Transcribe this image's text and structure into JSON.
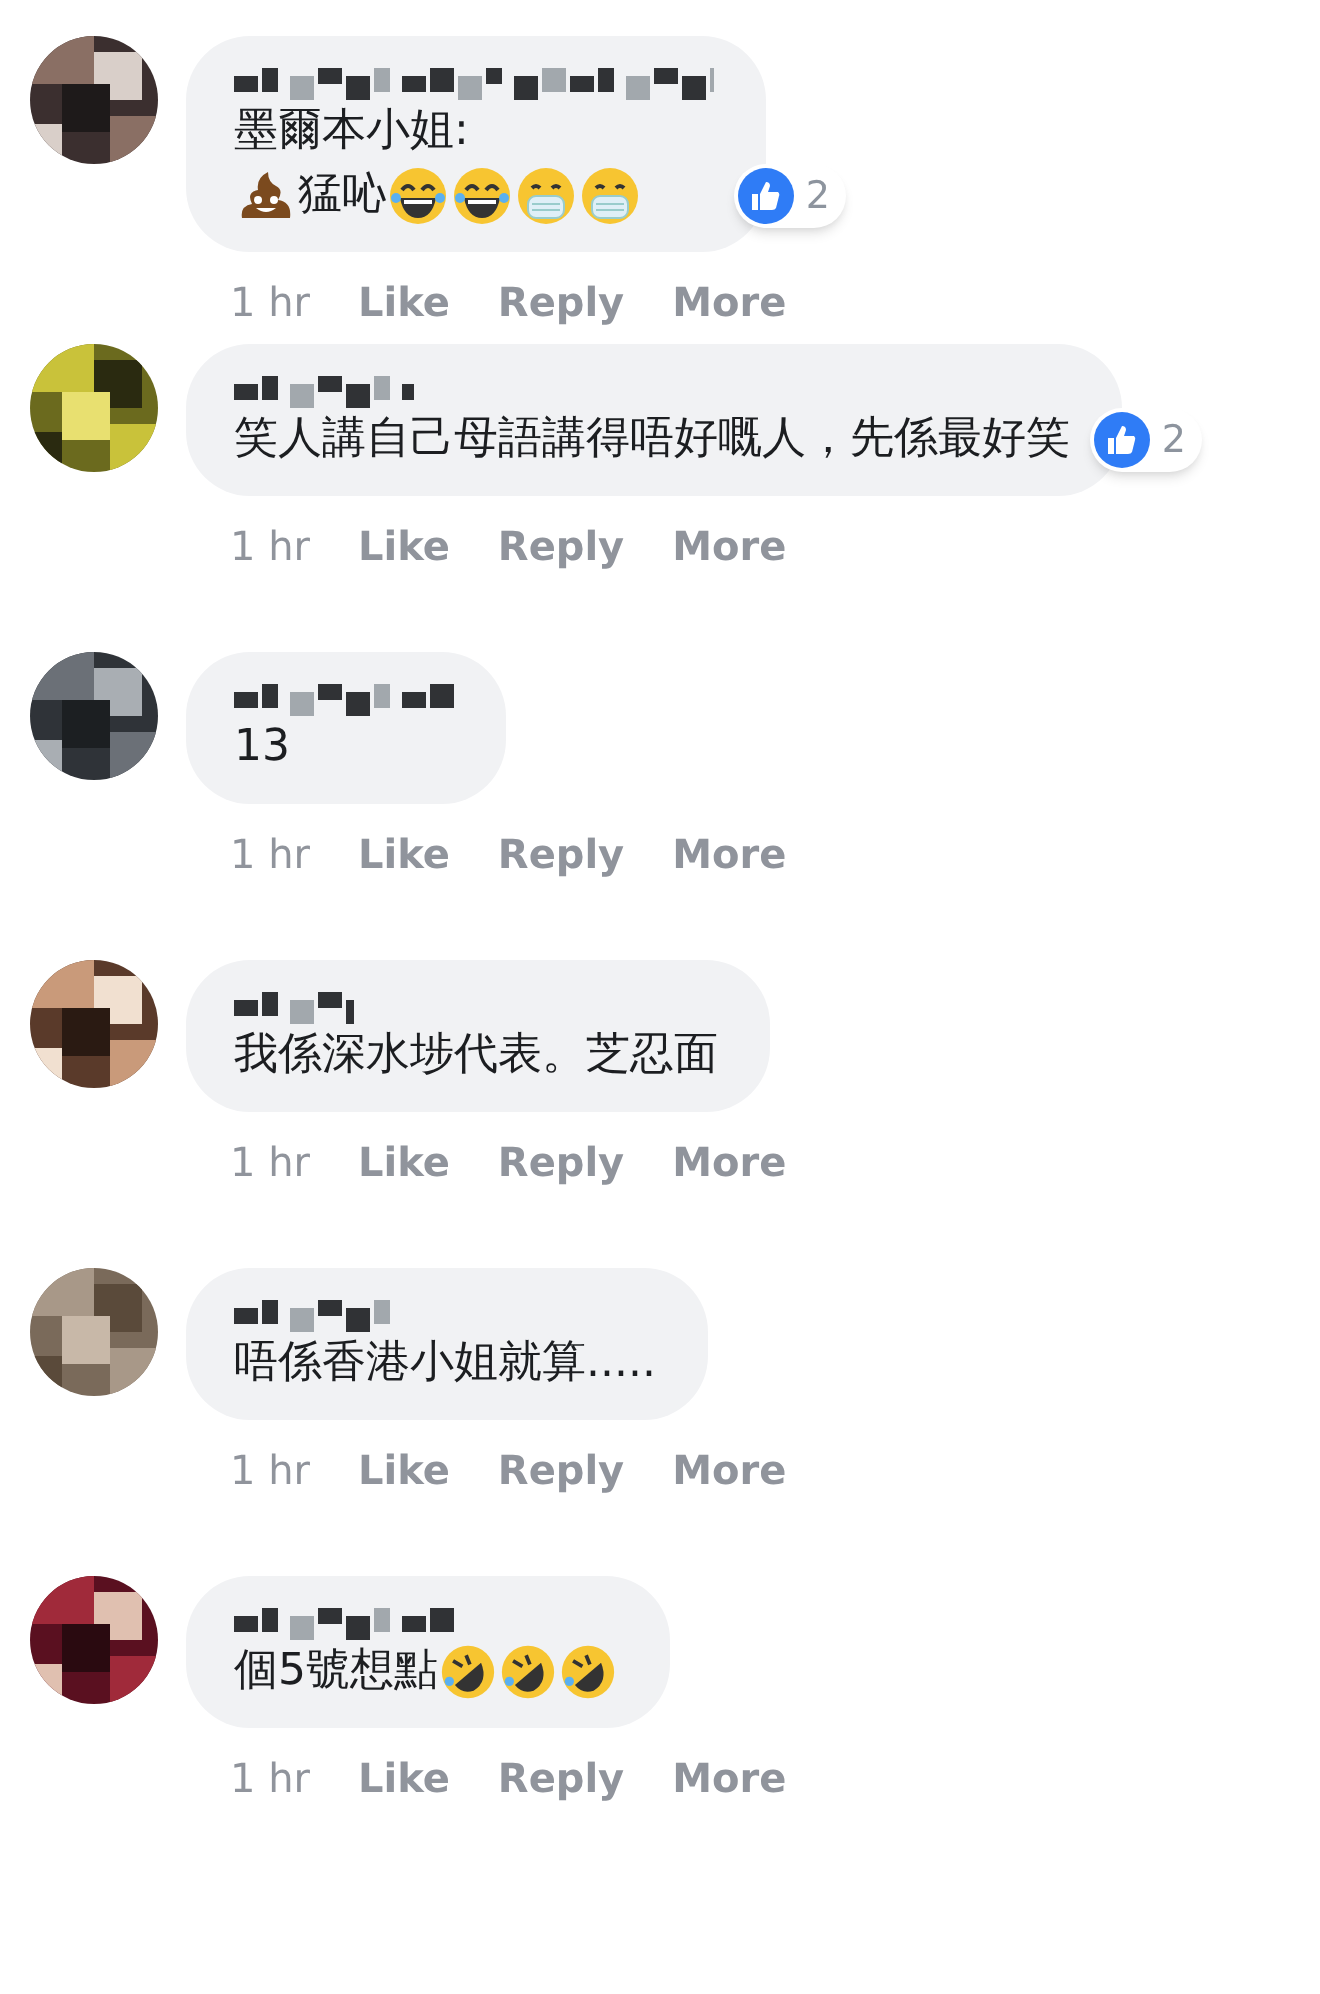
{
  "comments": [
    {
      "lines": [
        [
          {
            "kind": "text",
            "text": "墨爾本小姐:"
          }
        ],
        [
          {
            "kind": "poop"
          },
          {
            "kind": "text",
            "text": "猛吣"
          },
          {
            "kind": "laugh"
          },
          {
            "kind": "laugh"
          },
          {
            "kind": "mask"
          },
          {
            "kind": "mask"
          }
        ]
      ],
      "reaction_count": "2",
      "time": "1 hr",
      "actions": [
        "Like",
        "Reply",
        "More"
      ]
    },
    {
      "lines": [
        [
          {
            "kind": "text",
            "text": "笑人講自己母語講得唔好嘅人，先係最好笑"
          }
        ]
      ],
      "reaction_count": "2",
      "time": "1 hr",
      "actions": [
        "Like",
        "Reply",
        "More"
      ]
    },
    {
      "lines": [
        [
          {
            "kind": "text",
            "text": "13"
          }
        ]
      ],
      "time": "1 hr",
      "actions": [
        "Like",
        "Reply",
        "More"
      ]
    },
    {
      "lines": [
        [
          {
            "kind": "text",
            "text": "我係深水埗代表。芝忍面"
          }
        ]
      ],
      "time": "1 hr",
      "actions": [
        "Like",
        "Reply",
        "More"
      ]
    },
    {
      "lines": [
        [
          {
            "kind": "text",
            "text": "唔係香港小姐就算....."
          }
        ]
      ],
      "time": "1 hr",
      "actions": [
        "Like",
        "Reply",
        "More"
      ]
    },
    {
      "lines": [
        [
          {
            "kind": "text",
            "text": "個5號想點"
          },
          {
            "kind": "rofl"
          },
          {
            "kind": "rofl"
          },
          {
            "kind": "rofl"
          }
        ]
      ],
      "time": "1 hr",
      "actions": [
        "Like",
        "Reply",
        "More"
      ]
    }
  ]
}
